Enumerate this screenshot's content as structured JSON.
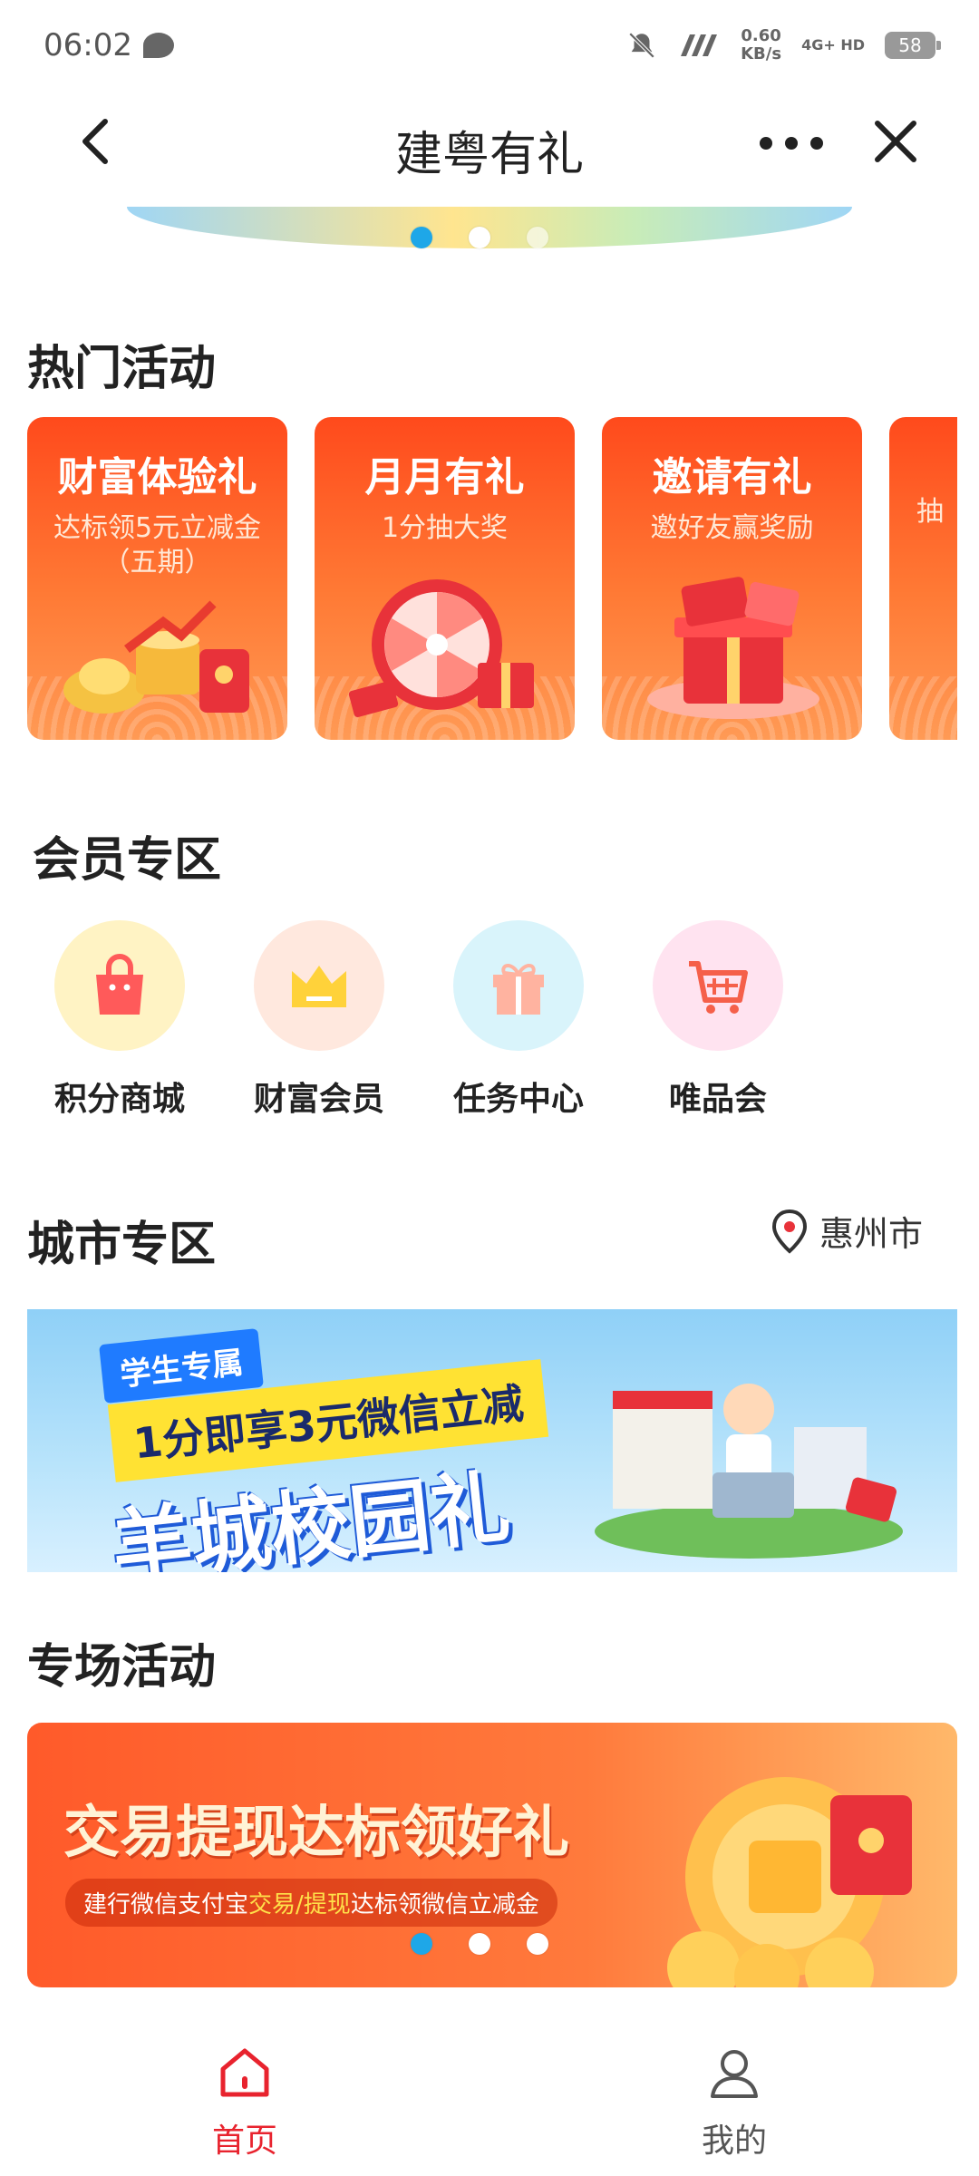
{
  "status_bar": {
    "time": "06:02",
    "speed_value": "0.60",
    "speed_unit": "KB/s",
    "network": "4G+ HD",
    "battery": "58"
  },
  "nav": {
    "title": "建粤有礼"
  },
  "hot_activities": {
    "title": "热门活动",
    "cards": [
      {
        "title": "财富体验礼",
        "sub": "达标领5元立减金",
        "sub2": "（五期）"
      },
      {
        "title": "月月有礼",
        "sub": "1分抽大奖",
        "sub2": ""
      },
      {
        "title": "邀请有礼",
        "sub": "邀好友赢奖励",
        "sub2": ""
      },
      {
        "title": "",
        "sub": "抽",
        "sub2": ""
      }
    ]
  },
  "member": {
    "title": "会员专区",
    "items": [
      {
        "label": "积分商城",
        "color": "#fff3c4"
      },
      {
        "label": "财富会员",
        "color": "#ffe8de"
      },
      {
        "label": "任务中心",
        "color": "#d9f4fb"
      },
      {
        "label": "唯品会",
        "color": "#ffe3f0"
      }
    ]
  },
  "city": {
    "title": "城市专区",
    "location": "惠州市",
    "banner": {
      "tag": "学生专属",
      "sub": "1分即享3元微信立减",
      "main": "羊城校园礼"
    }
  },
  "special": {
    "title": "专场活动",
    "banner": {
      "title": "交易提现达标领好礼",
      "sub_pre": "建行微信支付宝",
      "sub_hl1": "交易",
      "sub_sep": "/",
      "sub_hl2": "提现",
      "sub_post": "达标领微信立减金"
    }
  },
  "tabbar": {
    "home": "首页",
    "mine": "我的",
    "accent": "#e8232e"
  }
}
